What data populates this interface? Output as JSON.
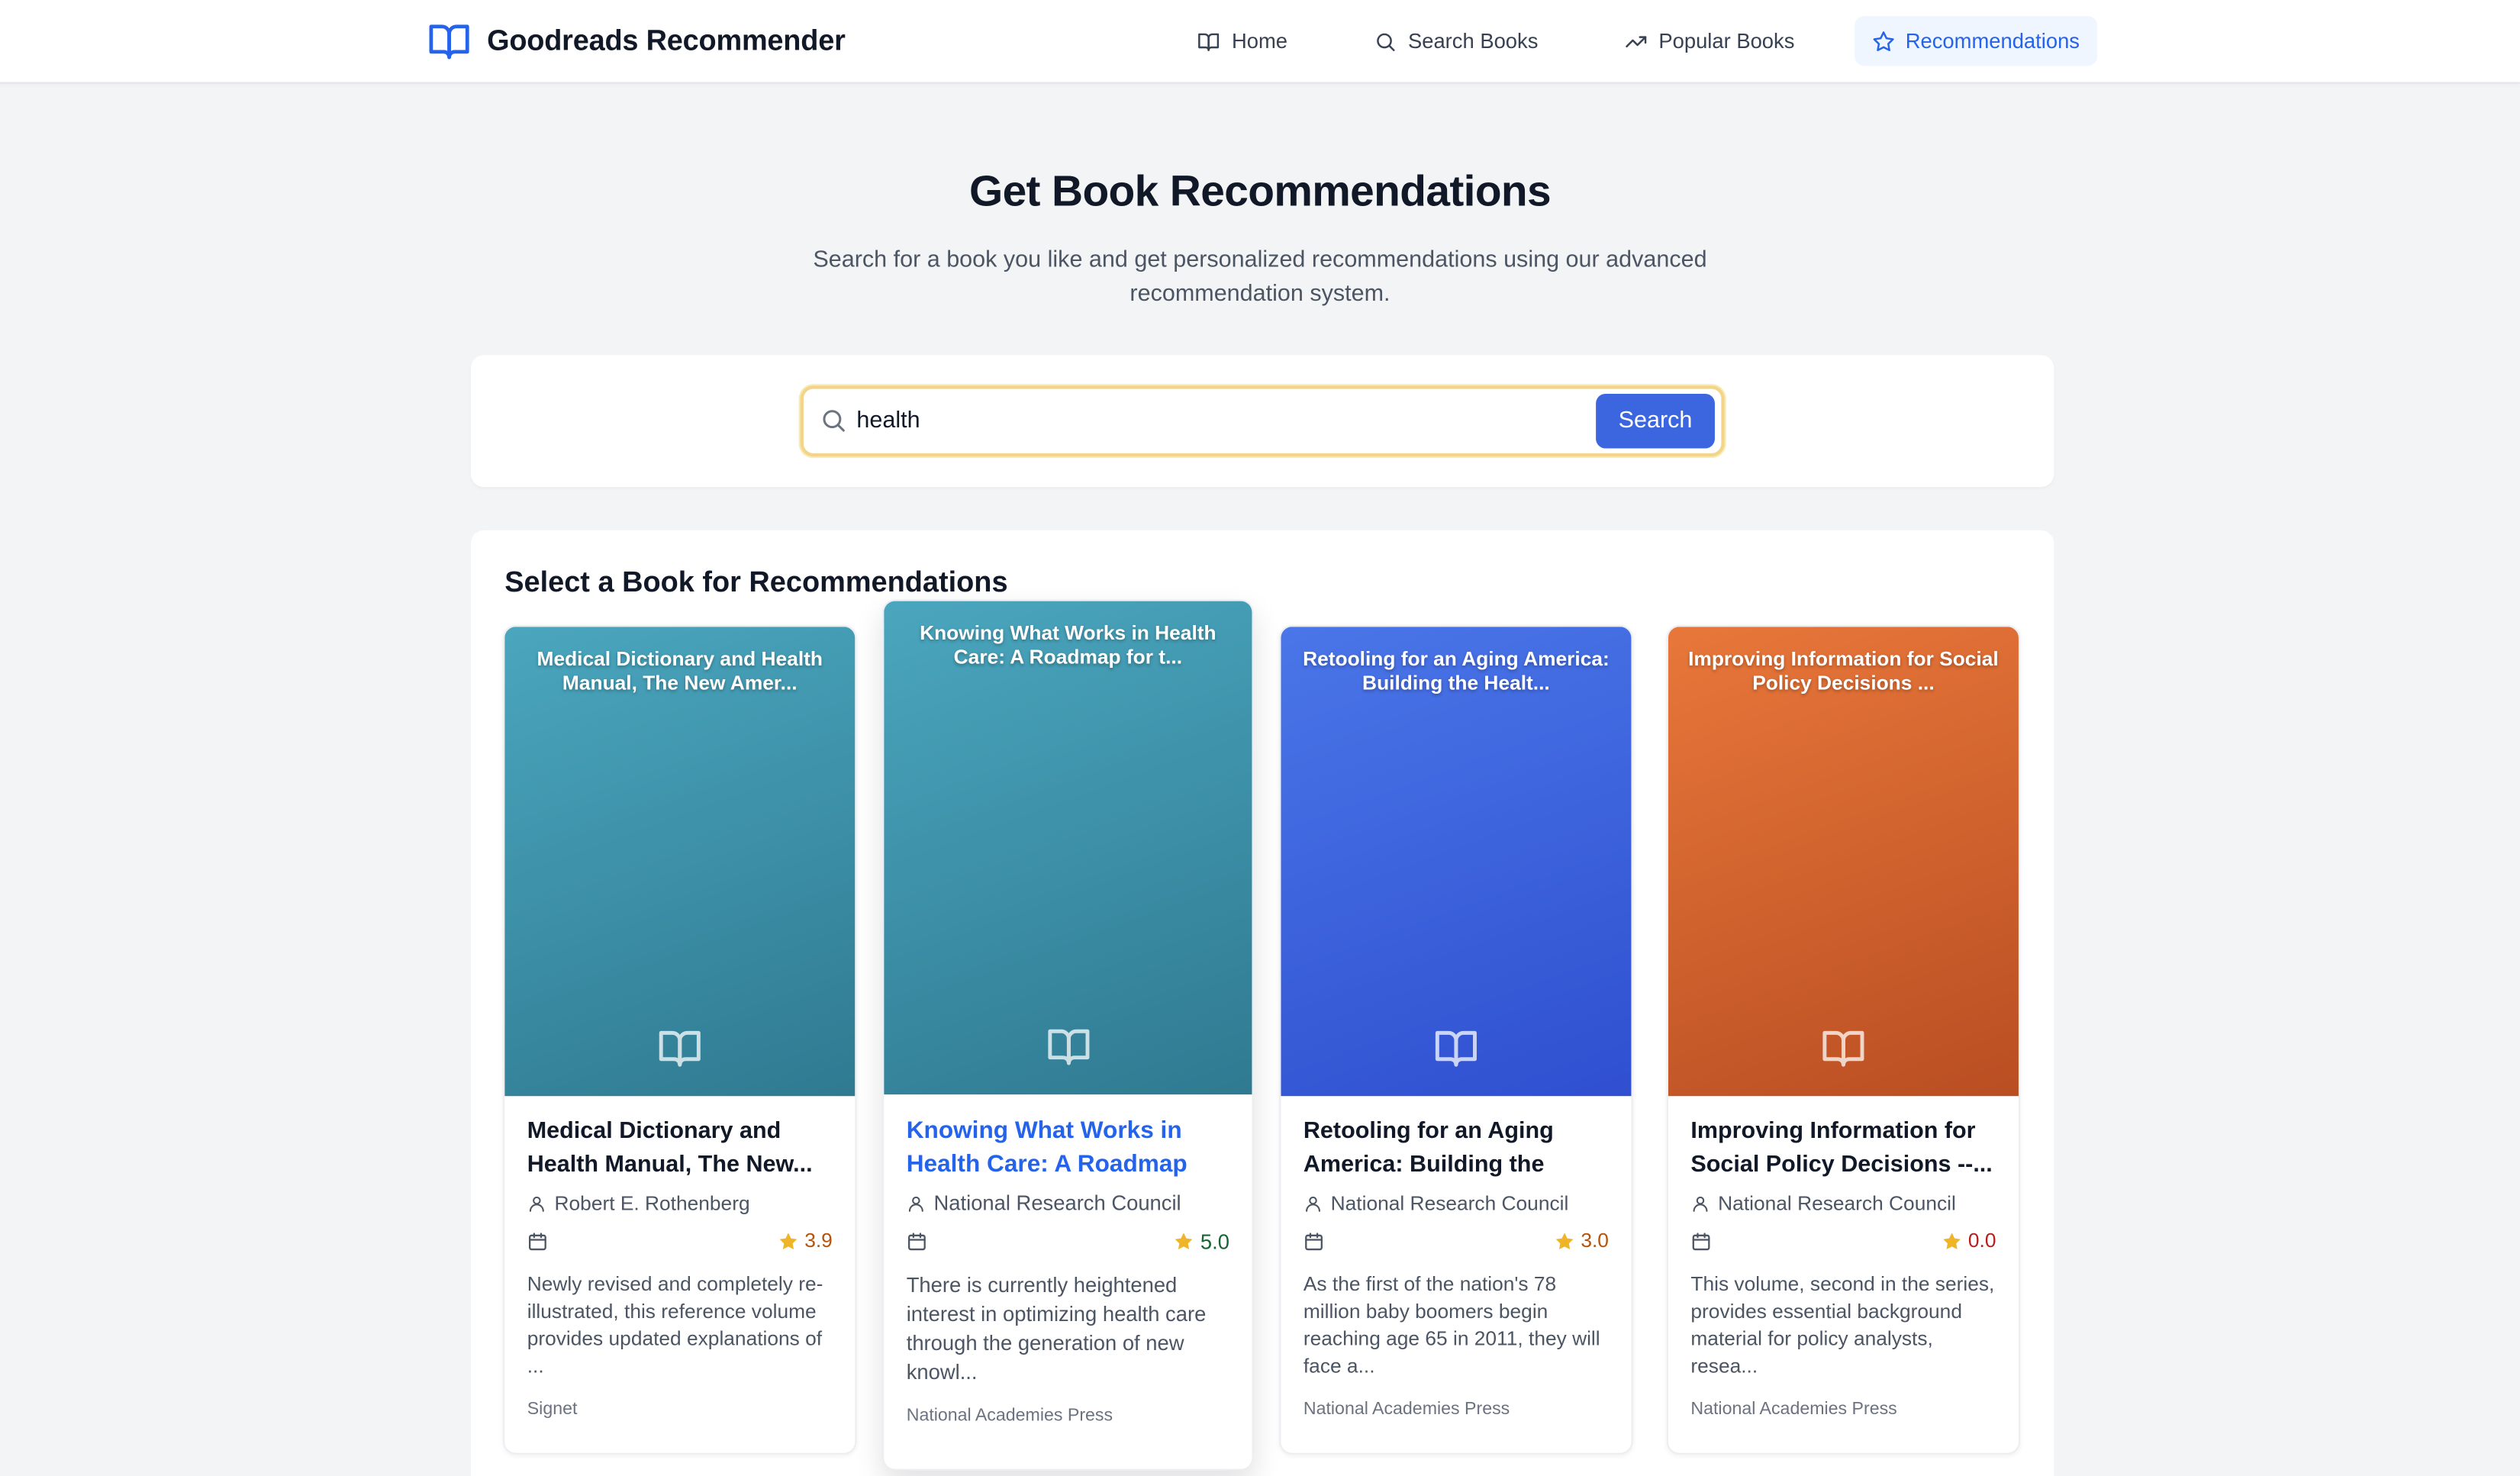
{
  "app": {
    "name": "Goodreads Recommender",
    "icon": "open-book-icon"
  },
  "nav": {
    "items": [
      {
        "label": "Home",
        "icon": "book-icon"
      },
      {
        "label": "Search Books",
        "icon": "search-icon"
      },
      {
        "label": "Popular Books",
        "icon": "trending-up-icon"
      },
      {
        "label": "Recommendations",
        "icon": "star-icon",
        "active": true
      }
    ]
  },
  "hero": {
    "title": "Get Book Recommendations",
    "subtitle": "Search for a book you like and get personalized recommendations using our advanced recommendation system."
  },
  "search": {
    "value": "health",
    "button_label": "Search"
  },
  "results": {
    "title": "Select a Book for Recommendations",
    "books": [
      {
        "cover_title": "Medical Dictionary and Health Manual, The New Amer...",
        "title": "Medical Dictionary and Health Manual, The New...",
        "author": "Robert E. Rothenberg",
        "rating": "3.9",
        "description": "Newly revised and completely re-illustrated, this reference volume provides updated explanations of ...",
        "publisher": "Signet",
        "cover_colors": [
          "#4aa6be",
          "#2f7a91"
        ]
      },
      {
        "cover_title": "Knowing What Works in Health Care: A Roadmap for t...",
        "title": "Knowing What Works in Health Care: A Roadmap fo...",
        "author": "National Research Council",
        "rating": "5.0",
        "description": "There is currently heightened interest in optimizing health care through the generation of new knowl...",
        "publisher": "National Academies Press",
        "cover_colors": [
          "#4aa6be",
          "#2f7a91"
        ]
      },
      {
        "cover_title": "Retooling for an Aging America: Building the Healt...",
        "title": "Retooling for an Aging America: Building the Heal...",
        "author": "National Research Council",
        "rating": "3.0",
        "description": "As the first of the nation's 78 million baby boomers begin reaching age 65 in 2011, they will face a...",
        "publisher": "National Academies Press",
        "cover_colors": [
          "#4a76e8",
          "#2f4fd0"
        ]
      },
      {
        "cover_title": "Improving Information for Social Policy Decisions ...",
        "title": "Improving Information for Social Policy Decisions --...",
        "author": "National Research Council",
        "rating": "0.0",
        "description": "This volume, second in the series, provides essential background material for policy analysts, resea...",
        "publisher": "National Academies Press",
        "cover_colors": [
          "#e8773a",
          "#b94e22"
        ]
      }
    ]
  },
  "colors": {
    "accent": "#2563eb",
    "star": "#f0b429"
  }
}
